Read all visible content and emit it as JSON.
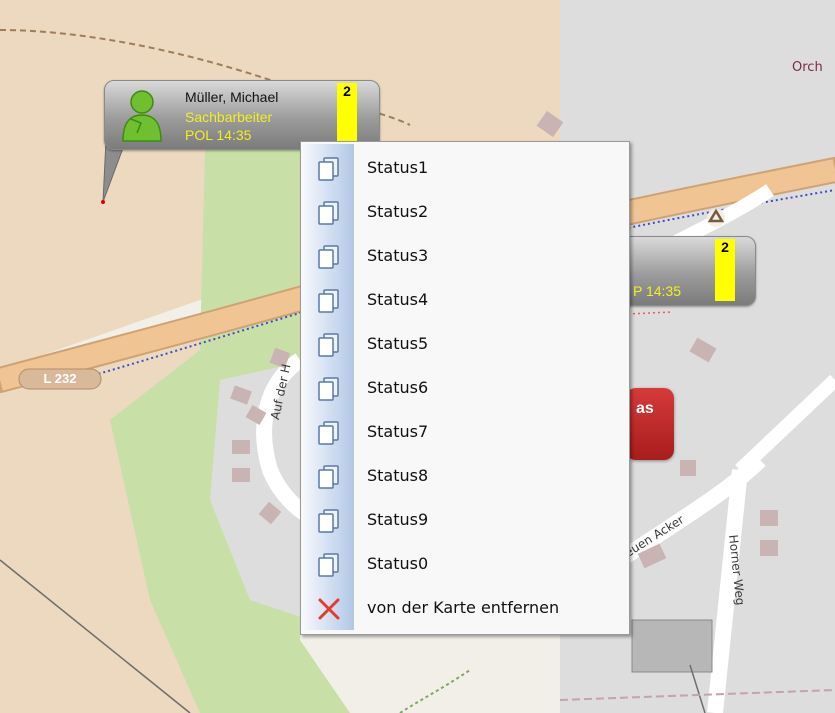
{
  "map": {
    "place_label": "Orch",
    "road_ref": "L 232",
    "street_labels": {
      "auf_der": "Auf der H",
      "neuen_acker": "euen Acker",
      "horner_weg": "Horner Weg"
    }
  },
  "markers": [
    {
      "name": "Müller, Michael",
      "role": "Sachbarbeiter",
      "time": "POL 14:35",
      "badge": "2",
      "icon": "person-icon"
    },
    {
      "time": "P 14:35",
      "badge": "2"
    }
  ],
  "red_button": {
    "text": "as"
  },
  "context_menu": {
    "items": [
      {
        "label": "Status1",
        "icon": "pages-icon"
      },
      {
        "label": "Status2",
        "icon": "pages-icon"
      },
      {
        "label": "Status3",
        "icon": "pages-icon"
      },
      {
        "label": "Status4",
        "icon": "pages-icon"
      },
      {
        "label": "Status5",
        "icon": "pages-icon"
      },
      {
        "label": "Status6",
        "icon": "pages-icon"
      },
      {
        "label": "Status7",
        "icon": "pages-icon"
      },
      {
        "label": "Status8",
        "icon": "pages-icon"
      },
      {
        "label": "Status9",
        "icon": "pages-icon"
      },
      {
        "label": "Status0",
        "icon": "pages-icon"
      },
      {
        "label": "von der Karte entfernen",
        "icon": "close-icon"
      }
    ]
  },
  "colors": {
    "badge": "#ffff00",
    "role_text": "#f4ef1c",
    "road": "#f1c494",
    "green": "#c8e0a8",
    "red_button": "#c62828"
  }
}
